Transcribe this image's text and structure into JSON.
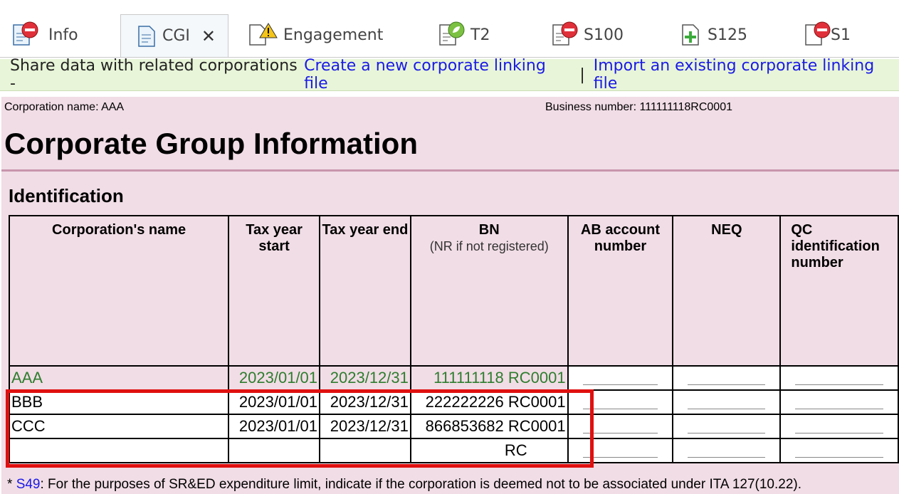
{
  "tabs": [
    {
      "label": "Info"
    },
    {
      "label": "CGI",
      "close": "✕"
    },
    {
      "label": "Engagement"
    },
    {
      "label": "T2"
    },
    {
      "label": "S100"
    },
    {
      "label": "S125"
    },
    {
      "label": "S1"
    }
  ],
  "share_bar": {
    "text": "Share data with related corporations - ",
    "link_create": "Create a new corporate linking file",
    "separator": "|",
    "link_import": "Import an existing corporate linking file"
  },
  "header": {
    "corporation_name": "Corporation name: AAA",
    "business_number": "Business number: 111111118RC0001",
    "title": "Corporate Group Information",
    "section": "Identification"
  },
  "table": {
    "columns": [
      {
        "label": "Corporation's name",
        "sub": ""
      },
      {
        "label": "Tax year start",
        "sub": ""
      },
      {
        "label": "Tax year end",
        "sub": ""
      },
      {
        "label": "BN",
        "sub": "(NR if not registered)"
      },
      {
        "label": "AB account number",
        "sub": ""
      },
      {
        "label": "NEQ",
        "sub": ""
      },
      {
        "label": "QC identification number",
        "sub": ""
      }
    ],
    "rows": [
      {
        "name": "AAA",
        "start": "2023/01/01",
        "end": "2023/12/31",
        "bn": "111111118 RC0001"
      },
      {
        "name": "BBB",
        "start": "2023/01/01",
        "end": "2023/12/31",
        "bn": "222222226 RC0001"
      },
      {
        "name": "CCC",
        "start": "2023/01/01",
        "end": "2023/12/31",
        "bn": "866853682 RC0001"
      },
      {
        "name": "",
        "start": "",
        "end": "",
        "bn": "RC"
      }
    ]
  },
  "footnote": {
    "star": "* ",
    "link": "S49",
    "text": ": For the purposes of SR&ED expenditure limit, indicate if the corporation is deemed not to be associated under ITA 127(10.22)."
  },
  "colors": {
    "form_bg": "#f1dde6",
    "share_bg": "#e8f5d8",
    "link": "#1a1ae6",
    "green_text": "#2e7d2e",
    "highlight": "#e01010"
  },
  "icons": [
    "document-icon",
    "no-entry-icon",
    "warning-icon",
    "leaf-icon",
    "plus-icon",
    "close-icon"
  ]
}
